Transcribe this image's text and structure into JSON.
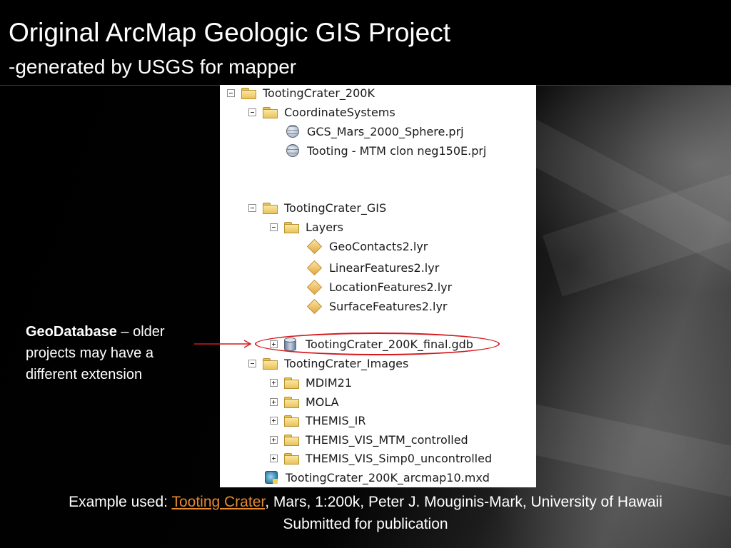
{
  "slide": {
    "title": "Original ArcMap Geologic GIS Project",
    "subtitle": "-generated by USGS for mapper"
  },
  "tree": {
    "root": "TootingCrater_200K",
    "coordinate_systems": {
      "label": "CoordinateSystems",
      "items": [
        "GCS_Mars_2000_Sphere.prj",
        "Tooting - MTM clon neg150E.prj"
      ]
    },
    "gis": {
      "label": "TootingCrater_GIS",
      "layers_label": "Layers",
      "layers": [
        "GeoContacts2.lyr",
        "LinearFeatures2.lyr",
        "LocationFeatures2.lyr",
        "SurfaceFeatures2.lyr"
      ],
      "gdb": "TootingCrater_200K_final.gdb"
    },
    "images": {
      "label": "TootingCrater_Images",
      "items": [
        "MDIM21",
        "MOLA",
        "THEMIS_IR",
        "THEMIS_VIS_MTM_controlled",
        "THEMIS_VIS_Simp0_uncontrolled"
      ]
    },
    "mxd": "TootingCrater_200K_arcmap10.mxd"
  },
  "callout": {
    "bold": "GeoDatabase",
    "rest": " – older projects may have  a different extension"
  },
  "caption": {
    "prefix": "Example used: ",
    "link": "Tooting Crater",
    "suffix": ", Mars, 1:200k, Peter J. Mouginis-Mark, University of Hawaii",
    "line2": "Submitted for publication"
  },
  "colors": {
    "highlight_ellipse": "#d5171a",
    "link": "#e68a2e"
  }
}
